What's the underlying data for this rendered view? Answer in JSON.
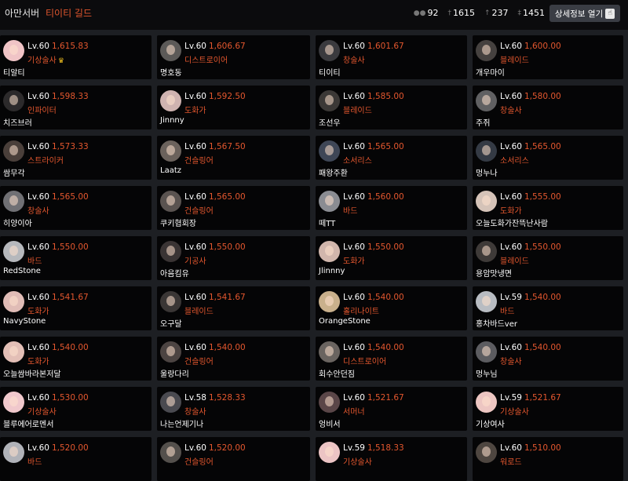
{
  "header": {
    "server": "아만서버",
    "guild": "티이티 길드",
    "stats": [
      {
        "icon": "members-icon",
        "value": "92"
      },
      {
        "icon": "sword-icon",
        "value": "1615"
      },
      {
        "icon": "arrow-up-icon",
        "value": "237"
      },
      {
        "icon": "dagger-icon",
        "value": "1451"
      }
    ],
    "detail_button": "상세정보 열기"
  },
  "members": [
    {
      "level": "Lv.60",
      "item_level": "1,615.83",
      "class": "기상술사",
      "name": "티알티",
      "crown": true,
      "avatar": "#f0c4c6"
    },
    {
      "level": "Lv.60",
      "item_level": "1,606.67",
      "class": "디스트로이어",
      "name": "명호동",
      "avatar": "#5c5a58"
    },
    {
      "level": "Lv.60",
      "item_level": "1,601.67",
      "class": "창술사",
      "name": "티이티",
      "avatar": "#3a3a3e"
    },
    {
      "level": "Lv.60",
      "item_level": "1,600.00",
      "class": "블레이드",
      "name": "개우마이",
      "avatar": "#45413f"
    },
    {
      "level": "Lv.60",
      "item_level": "1,598.33",
      "class": "인파이터",
      "name": "치즈브러",
      "avatar": "#2c2a2b"
    },
    {
      "level": "Lv.60",
      "item_level": "1,592.50",
      "class": "도화가",
      "name": "Jinnny",
      "avatar": "#cfb3b0"
    },
    {
      "level": "Lv.60",
      "item_level": "1,585.00",
      "class": "블레이드",
      "name": "조선우",
      "avatar": "#3b3836"
    },
    {
      "level": "Lv.60",
      "item_level": "1,580.00",
      "class": "창술사",
      "name": "주쥐",
      "avatar": "#606062"
    },
    {
      "level": "Lv.60",
      "item_level": "1,573.33",
      "class": "스트라이커",
      "name": "쌈무각",
      "avatar": "#4a3f3a"
    },
    {
      "level": "Lv.60",
      "item_level": "1,567.50",
      "class": "건슬링어",
      "name": "Laatz",
      "avatar": "#6b625c"
    },
    {
      "level": "Lv.60",
      "item_level": "1,565.00",
      "class": "소서리스",
      "name": "패왕주환",
      "avatar": "#3e4656"
    },
    {
      "level": "Lv.60",
      "item_level": "1,565.00",
      "class": "소서리스",
      "name": "멍누나",
      "avatar": "#343a44"
    },
    {
      "level": "Lv.60",
      "item_level": "1,565.00",
      "class": "창술사",
      "name": "히양이아",
      "avatar": "#707074"
    },
    {
      "level": "Lv.60",
      "item_level": "1,565.00",
      "class": "건슬링어",
      "name": "쿠키협회장",
      "avatar": "#5a5350"
    },
    {
      "level": "Lv.60",
      "item_level": "1,560.00",
      "class": "바드",
      "name": "떼TT",
      "avatar": "#8a8c92"
    },
    {
      "level": "Lv.60",
      "item_level": "1,555.00",
      "class": "도화가",
      "name": "오늘도화가잔뜩난사람",
      "avatar": "#d5c3b8"
    },
    {
      "level": "Lv.60",
      "item_level": "1,550.00",
      "class": "바드",
      "name": "RedStone",
      "avatar": "#b6b8bc"
    },
    {
      "level": "Lv.60",
      "item_level": "1,550.00",
      "class": "기공사",
      "name": "아음킴유",
      "avatar": "#3a3434"
    },
    {
      "level": "Lv.60",
      "item_level": "1,550.00",
      "class": "도화가",
      "name": "Jlinnny",
      "avatar": "#d1b6ac"
    },
    {
      "level": "Lv.60",
      "item_level": "1,550.00",
      "class": "블레이드",
      "name": "용암맛냉면",
      "avatar": "#3e3a38"
    },
    {
      "level": "Lv.60",
      "item_level": "1,541.67",
      "class": "도화가",
      "name": "NavyStone",
      "avatar": "#e0bcb6"
    },
    {
      "level": "Lv.60",
      "item_level": "1,541.67",
      "class": "블레이드",
      "name": "오구달",
      "avatar": "#3a3635"
    },
    {
      "level": "Lv.60",
      "item_level": "1,540.00",
      "class": "홀리나이트",
      "name": "OrangeStone",
      "avatar": "#c9b08c"
    },
    {
      "level": "Lv.59",
      "item_level": "1,540.00",
      "class": "바드",
      "name": "홍차바드ver",
      "avatar": "#b8bcc2"
    },
    {
      "level": "Lv.60",
      "item_level": "1,540.00",
      "class": "도화가",
      "name": "오늘쌈바라본저달",
      "avatar": "#e3bfb6"
    },
    {
      "level": "Lv.60",
      "item_level": "1,540.00",
      "class": "건슬링어",
      "name": "울랑다리",
      "avatar": "#4c4442"
    },
    {
      "level": "Lv.60",
      "item_level": "1,540.00",
      "class": "디스트로이어",
      "name": "회수안던짐",
      "avatar": "#6a6460"
    },
    {
      "level": "Lv.60",
      "item_level": "1,540.00",
      "class": "창술사",
      "name": "멍누님",
      "avatar": "#5c5c60"
    },
    {
      "level": "Lv.60",
      "item_level": "1,530.00",
      "class": "기상술사",
      "name": "블루에어로멘서",
      "avatar": "#f0c8cc"
    },
    {
      "level": "Lv.58",
      "item_level": "1,528.33",
      "class": "창술사",
      "name": "나는언제기나",
      "avatar": "#4a4a50"
    },
    {
      "level": "Lv.60",
      "item_level": "1,521.67",
      "class": "서머너",
      "name": "엉비서",
      "avatar": "#5a4648"
    },
    {
      "level": "Lv.59",
      "item_level": "1,521.67",
      "class": "기상술사",
      "name": "기상여사",
      "avatar": "#edc6c2"
    },
    {
      "level": "Lv.60",
      "item_level": "1,520.00",
      "class": "바드",
      "name": "",
      "avatar": "#b0b2b8"
    },
    {
      "level": "Lv.60",
      "item_level": "1,520.00",
      "class": "건슬링어",
      "name": "",
      "avatar": "#54504c"
    },
    {
      "level": "Lv.59",
      "item_level": "1,518.33",
      "class": "기상술사",
      "name": "",
      "avatar": "#ecc4c4"
    },
    {
      "level": "Lv.60",
      "item_level": "1,510.00",
      "class": "워로드",
      "name": "",
      "avatar": "#4e4640"
    }
  ]
}
